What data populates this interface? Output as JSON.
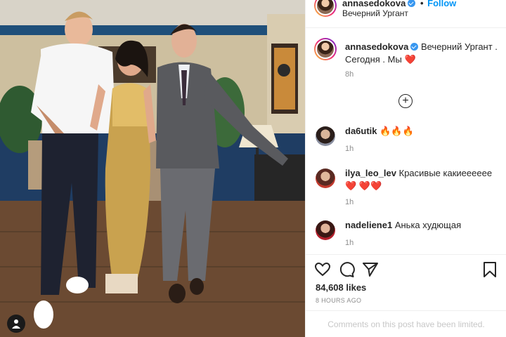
{
  "post": {
    "username": "annasedokova",
    "location": "Вечерний Ургант",
    "follow_separator": "•",
    "follow_label": "Follow",
    "caption_text": "Вечерний Ургант . Сегодня . Мы",
    "caption_emoji": "❤️",
    "caption_time": "8h",
    "load_more_icon": "plus-circle-icon",
    "likes": "84,608 likes",
    "posted_time": "8 HOURS AGO",
    "comments_limited": "Comments on this post have been limited."
  },
  "comments": [
    {
      "username": "da6utik",
      "text": "",
      "emoji": "🔥🔥🔥",
      "time": "1h"
    },
    {
      "username": "ilya_leo_lev",
      "text": "Красивые какиееееее",
      "emoji": "❤️ ❤️❤️",
      "time": "1h"
    },
    {
      "username": "nadeliene1",
      "text": "Анька худющая",
      "emoji": "",
      "time": "1h"
    }
  ],
  "icons": [
    "like-icon",
    "comment-icon",
    "share-icon",
    "save-icon",
    "user-tag-icon",
    "verified-icon"
  ],
  "colors": {
    "link": "#0095f6",
    "verified": "#3897f0",
    "heart": "#ed2b3a",
    "muted": "#8e8e8e",
    "border": "#efefef"
  }
}
